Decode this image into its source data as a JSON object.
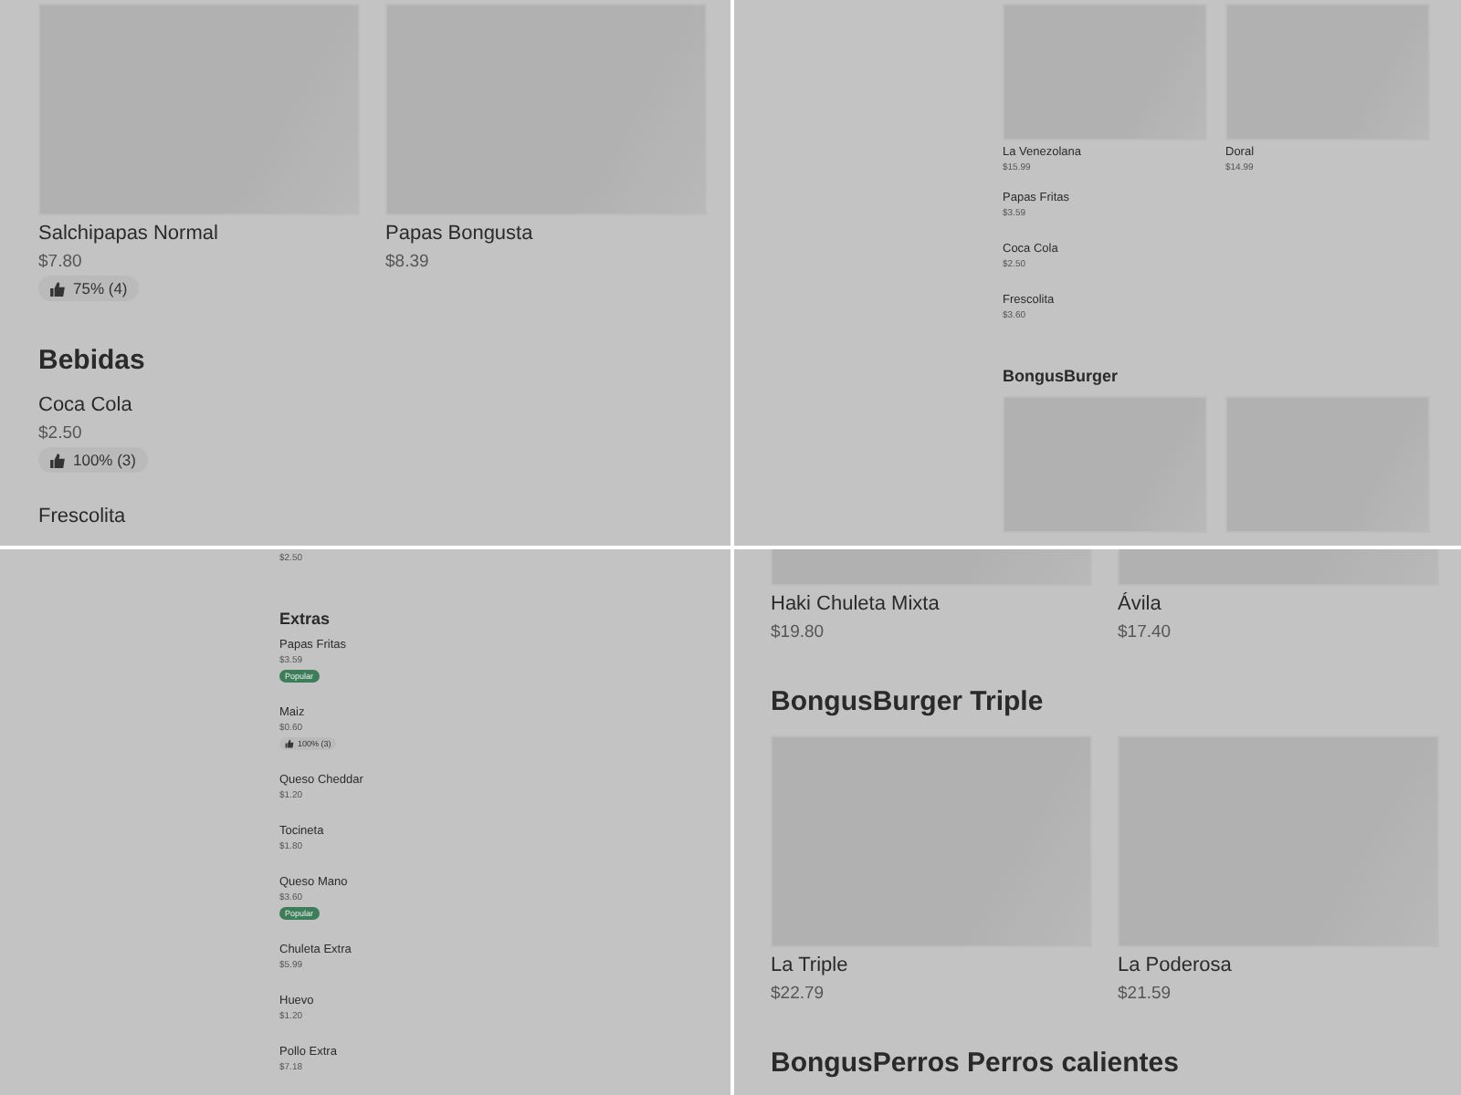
{
  "panels": [
    {
      "blocks": [
        {
          "kind": "cards",
          "cards": [
            {
              "name": "Salchipapas Normal",
              "price": "$7.80",
              "badge": {
                "kind": "rating",
                "text": "75% (4)"
              }
            },
            {
              "name": "Papas Bongusta",
              "price": "$8.39"
            }
          ]
        },
        {
          "kind": "heading",
          "text": "Bebidas"
        },
        {
          "kind": "item",
          "name": "Coca Cola",
          "price": "$2.50",
          "badge": {
            "kind": "rating",
            "text": "100% (3)"
          }
        },
        {
          "kind": "item",
          "name": "Frescolita"
        }
      ]
    },
    {
      "blocks": [
        {
          "kind": "cards",
          "cards": [
            {
              "name": "La Venezolana",
              "price": "$15.99"
            },
            {
              "name": "Doral",
              "price": "$14.99"
            }
          ]
        },
        {
          "kind": "item",
          "name": "Papas Fritas",
          "price": "$3.59"
        },
        {
          "kind": "item",
          "name": "Coca Cola",
          "price": "$2.50"
        },
        {
          "kind": "item",
          "name": "Frescolita",
          "price": "$3.60"
        },
        {
          "kind": "heading",
          "text": "BongusBurger"
        },
        {
          "kind": "cards",
          "cards": [
            {
              "kind": "photo"
            },
            {
              "kind": "photo"
            }
          ]
        }
      ]
    },
    {
      "blocks": [
        {
          "kind": "item",
          "price": "$2.50"
        },
        {
          "kind": "heading",
          "text": "Extras"
        },
        {
          "kind": "item",
          "name": "Papas Fritas",
          "price": "$3.59",
          "badge": {
            "kind": "popular",
            "text": "Popular"
          }
        },
        {
          "kind": "item",
          "name": "Maiz",
          "price": "$0.60",
          "badge": {
            "kind": "rating",
            "text": "100% (3)"
          }
        },
        {
          "kind": "item",
          "name": "Queso Cheddar",
          "price": "$1.20"
        },
        {
          "kind": "item",
          "name": "Tocineta",
          "price": "$1.80"
        },
        {
          "kind": "item",
          "name": "Queso Mano",
          "price": "$3.60",
          "badge": {
            "kind": "popular",
            "text": "Popular"
          }
        },
        {
          "kind": "item",
          "name": "Chuleta Extra",
          "price": "$5.99"
        },
        {
          "kind": "item",
          "name": "Huevo",
          "price": "$1.20"
        },
        {
          "kind": "item",
          "name": "Pollo Extra",
          "price": "$7.18"
        }
      ]
    },
    {
      "blocks": [
        {
          "kind": "cards",
          "cards": [
            {
              "name": "Haki Chuleta Mixta",
              "price": "$19.80"
            },
            {
              "name": "Ávila",
              "price": "$17.40"
            }
          ]
        },
        {
          "kind": "heading",
          "text": "BongusBurger Triple"
        },
        {
          "kind": "cards",
          "cards": [
            {
              "name": "La Triple",
              "price": "$22.79"
            },
            {
              "name": "La Poderosa",
              "price": "$21.59"
            }
          ]
        },
        {
          "kind": "heading",
          "text": "BongusPerros Perros calientes"
        }
      ]
    }
  ]
}
